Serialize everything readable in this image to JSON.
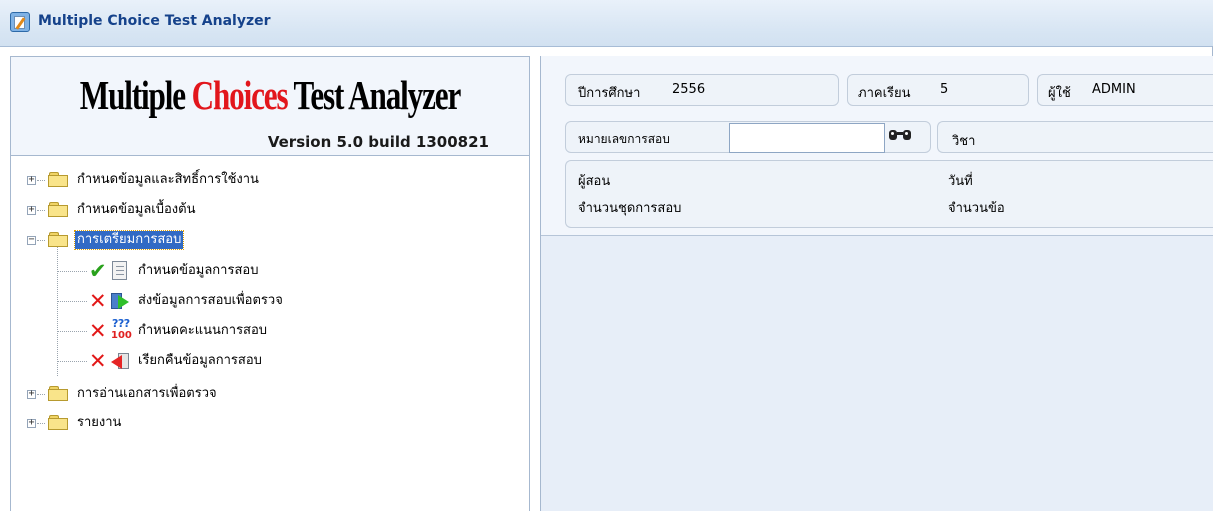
{
  "window": {
    "title": "Multiple Choice Test Analyzer"
  },
  "logo": {
    "part1": "Multiple ",
    "part2": "Choices",
    "part3": " Test Analyzer",
    "version": "Version 5.0  build 1300821"
  },
  "tree": {
    "nodes": [
      {
        "label": "กำหนดข้อมูลและสิทธิ์การใช้งาน",
        "expander": "+"
      },
      {
        "label": "กำหนดข้อมูลเบื้องต้น",
        "expander": "+"
      },
      {
        "label": "การเตรียมการสอบ",
        "expander": "−",
        "selected": true
      },
      {
        "label": "การอ่านเอกสารเพื่อตรวจ",
        "expander": "+"
      },
      {
        "label": "รายงาน",
        "expander": "+"
      }
    ],
    "children": [
      {
        "label": "กำหนดข้อมูลการสอบ",
        "status": "✔",
        "status_name": "check-icon",
        "icon": "document-icon"
      },
      {
        "label": "ส่งข้อมูลการสอบเพื่อตรวจ",
        "status": "✕",
        "status_name": "cross-icon",
        "icon": "send-icon"
      },
      {
        "label": "กำหนดคะแนนการสอบ",
        "status": "✕",
        "status_name": "cross-icon",
        "icon": "score-icon",
        "icon_top": "???",
        "icon_bottom": "100"
      },
      {
        "label": "เรียกคืนข้อมูลการสอบ",
        "status": "✕",
        "status_name": "cross-icon",
        "icon": "recall-icon"
      }
    ]
  },
  "info": {
    "academic_year_label": "ปีการศึกษา",
    "academic_year_value": "2556",
    "semester_label": "ภาคเรียน",
    "semester_value": "5",
    "user_label": "ผู้ใช้",
    "user_value": "ADMIN",
    "exam_number_label": "หมายเลขการสอบ",
    "exam_number_value": "",
    "subject_label": "วิชา",
    "teacher_label": "ผู้สอน",
    "date_label": "วันที่",
    "test_sets_label": "จำนวนชุดการสอบ",
    "questions_label": "จำนวนข้อ"
  },
  "colors": {
    "title_blue": "#15428b",
    "logo_red": "#e2161c",
    "selection": "#316ac5",
    "ok_green": "#29a11c",
    "error_red": "#e21818"
  }
}
